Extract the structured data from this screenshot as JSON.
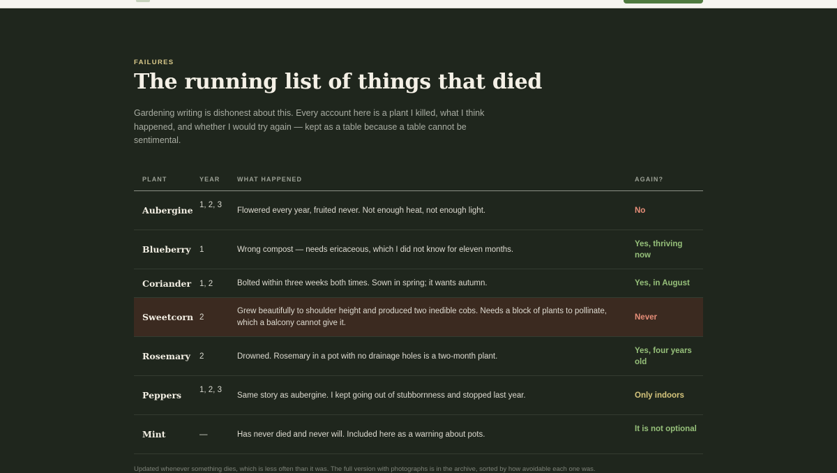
{
  "header": {
    "brand_color": "#4f7a3f",
    "page_background": "#1f261d"
  },
  "section": {
    "eyebrow": "FAILURES",
    "title": "The running list of things that died",
    "intro": "Gardening writing is dishonest about this. Every account here is a plant I killed, what I think happened, and whether I would try again — kept as a table because a table cannot be sentimental."
  },
  "table": {
    "columns": {
      "plant": "PLANT",
      "year": "YEAR",
      "what": "WHAT HAPPENED",
      "again": "AGAIN?"
    },
    "rows": [
      {
        "plant": "Aubergine",
        "year": "1, 2, 3",
        "what": "Flowered every year, fruited never. Not enough heat, not enough light.",
        "again": "No",
        "again_tone": "no"
      },
      {
        "plant": "Blueberry",
        "year": "1",
        "what": "Wrong compost — needs ericaceous, which I did not know for eleven months.",
        "again": "Yes, thriving now",
        "again_tone": "yes"
      },
      {
        "plant": "Coriander",
        "year": "1, 2",
        "what": "Bolted within three weeks both times. Sown in spring; it wants autumn.",
        "again": "Yes, in August",
        "again_tone": "yes"
      },
      {
        "plant": "Sweetcorn",
        "year": "2",
        "what": "Grew beautifully to shoulder height and produced two inedible cobs. Needs a block of plants to pollinate, which a balcony cannot give it.",
        "again": "Never",
        "again_tone": "no",
        "highlighted": true
      },
      {
        "plant": "Rosemary",
        "year": "2",
        "what": "Drowned. Rosemary in a pot with no drainage holes is a two-month plant.",
        "again": "Yes, four years old",
        "again_tone": "yes"
      },
      {
        "plant": "Peppers",
        "year": "1, 2, 3",
        "what": "Same story as aubergine. I kept going out of stubbornness and stopped last year.",
        "again": "Only indoors",
        "again_tone": "maybe"
      },
      {
        "plant": "Mint",
        "year": "—",
        "what": "Has never died and never will. Included here as a warning about pots.",
        "again": "It is not optional",
        "again_tone": "yes"
      }
    ]
  },
  "footer": {
    "note": "Updated whenever something dies, which is less often than it was. The full version with photographs is in the archive, sorted by how avoidable each one was."
  },
  "colors": {
    "eyebrow": "#d9c98a",
    "again_no": "#e78e79",
    "again_yes": "#96c07a",
    "again_maybe": "#d6c57c",
    "highlight_row": "#3b2a20"
  }
}
